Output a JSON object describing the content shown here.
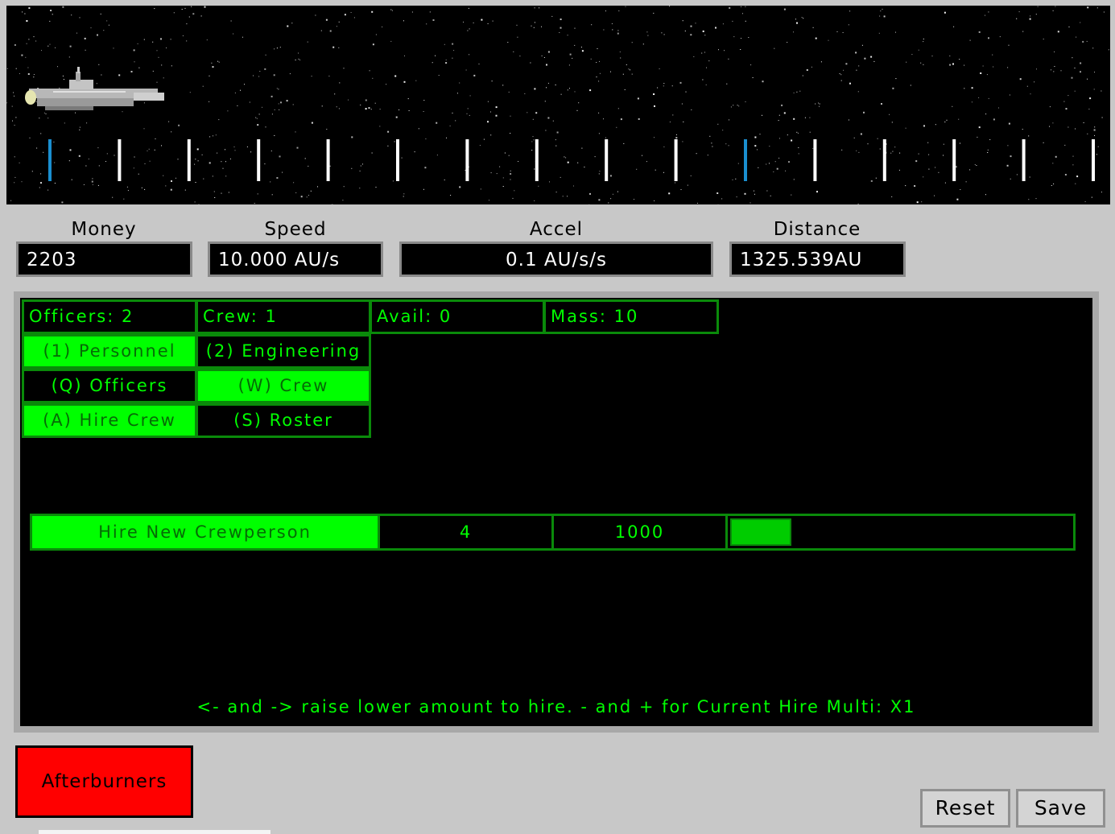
{
  "stats": {
    "money": {
      "label": "Money",
      "value": "2203"
    },
    "speed": {
      "label": "Speed",
      "value": "10.000 AU/s"
    },
    "accel": {
      "label": "Accel",
      "value": "0.1 AU/s/s"
    },
    "distance": {
      "label": "Distance",
      "value": "1325.539AU"
    }
  },
  "summary": {
    "officers": "Officers: 2",
    "crew": "Crew: 1",
    "avail": "Avail: 0",
    "mass": "Mass: 10"
  },
  "tabs": {
    "personnel": "(1) Personnel",
    "engineering": "(2) Engineering"
  },
  "subtabs": {
    "officers": "(Q) Officers",
    "crew": "(W) Crew"
  },
  "actions": {
    "hire_crew": "(A) Hire Crew",
    "roster": "(S) Roster"
  },
  "hire": {
    "label": "Hire New Crewperson",
    "amount": "4",
    "cost": "1000",
    "progress_fraction": 0.06
  },
  "hint": "<- and -> raise lower amount to hire. - and + for Current Hire Multi: X1",
  "buttons": {
    "afterburners": "Afterburners",
    "reset": "Reset",
    "save": "Save"
  },
  "colors": {
    "terminal_green": "#00ff00",
    "afterburners_red": "#ff0000",
    "marker_blue": "#1a8fd0"
  },
  "icons": {
    "ship": "spaceship-icon"
  }
}
